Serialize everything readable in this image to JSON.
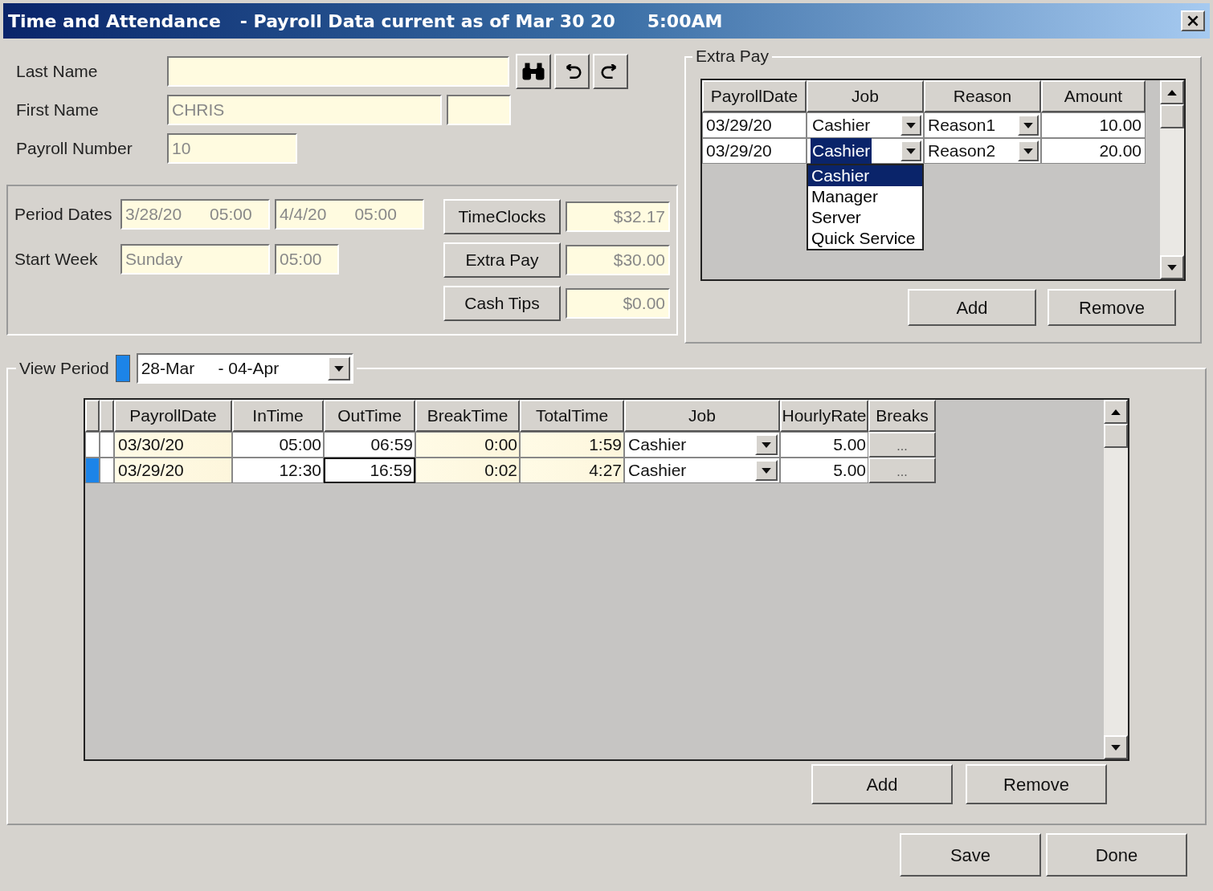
{
  "window": {
    "title": "Time and Attendance",
    "subtitle": "- Payroll Data current as of Mar 30 20",
    "time": "5:00AM"
  },
  "employee": {
    "fields": [
      {
        "label": "Last Name"
      },
      {
        "label": "First Name",
        "value": "CHRIS"
      },
      {
        "label": "Payroll Number",
        "value": "10"
      }
    ]
  },
  "period": {
    "rows": [
      {
        "label": "Period Dates",
        "values": [
          "3/28/20      05:00",
          "4/4/20      05:00"
        ]
      },
      {
        "label": "Start Week",
        "values": [
          "Sunday",
          "05:00"
        ]
      }
    ],
    "totals": [
      {
        "button": "TimeClocks",
        "amount": "$32.17"
      },
      {
        "button": "Extra Pay",
        "amount": "$30.00"
      },
      {
        "button": "Cash Tips",
        "amount": "$0.00"
      }
    ]
  },
  "extra_pay": {
    "title": "Extra Pay",
    "columns": [
      "PayrollDate",
      "Job",
      "Reason",
      "Amount"
    ],
    "rows": [
      {
        "date": "03/29/20",
        "job": "Cashier",
        "reason": "Reason1",
        "amount": "10.00",
        "selected": false
      },
      {
        "date": "03/29/20",
        "job": "Cashier",
        "reason": "Reason2",
        "amount": "20.00",
        "selected": true
      }
    ],
    "job_dropdown": [
      {
        "label": "Cashier",
        "selected": true
      },
      {
        "label": "Manager",
        "selected": false
      },
      {
        "label": "Server",
        "selected": false
      },
      {
        "label": "Quick Service",
        "selected": false
      }
    ],
    "buttons": [
      "Add",
      "Remove"
    ]
  },
  "view_period": {
    "label": "View Period",
    "value": "28-Mar     - 04-Apr"
  },
  "time_grid": {
    "columns": [
      "PayrollDate",
      "InTime",
      "OutTime",
      "BreakTime",
      "TotalTime",
      "Job",
      "HourlyRate",
      "Breaks"
    ],
    "rows": [
      {
        "date": "03/30/20",
        "in": "05:00",
        "out": "06:59",
        "break": "0:00",
        "total": "1:59",
        "job": "Cashier",
        "rate": "5.00",
        "breaks": "...",
        "selected": false
      },
      {
        "date": "03/29/20",
        "in": "12:30",
        "out": "16:59",
        "break": "0:02",
        "total": "4:27",
        "job": "Cashier",
        "rate": "5.00",
        "breaks": "...",
        "selected": true
      }
    ],
    "buttons": [
      "Add",
      "Remove"
    ]
  },
  "footer_buttons": [
    "Save",
    "Done"
  ]
}
